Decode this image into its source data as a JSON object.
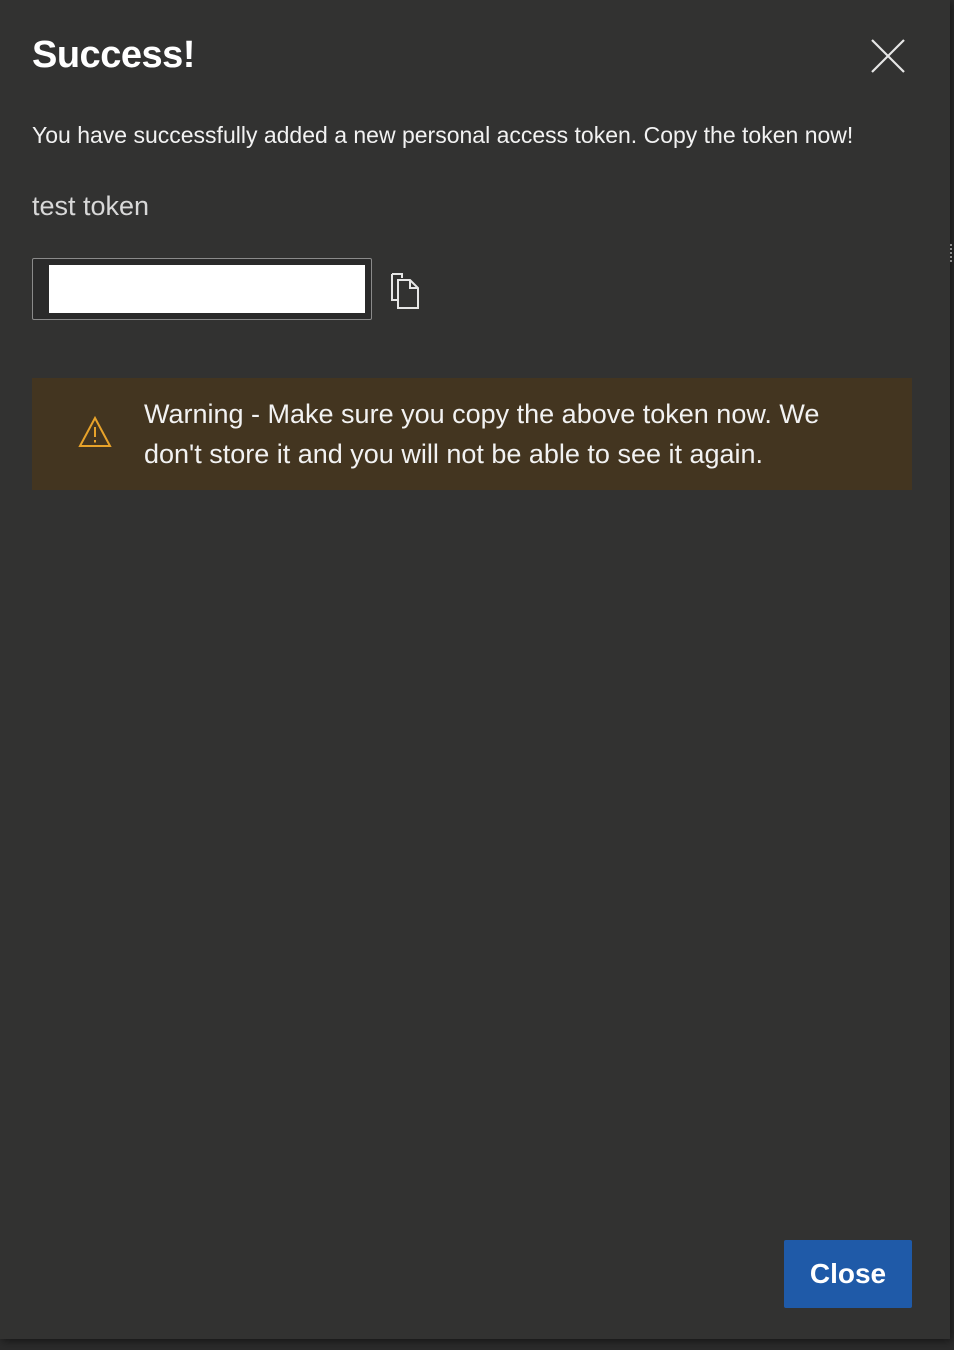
{
  "dialog": {
    "title": "Success!",
    "close_icon": "close-icon",
    "message": "You have successfully added a new personal access token. Copy the token now!",
    "token_name": "test token",
    "token_value": "",
    "copy_icon": "copy-icon",
    "warning": {
      "icon": "warning-icon",
      "text": "Warning - Make sure you copy the above token now. We don't store it and you will not be able to see it again.",
      "background_color": "#433520",
      "icon_color": "#e8a32a"
    },
    "close_button_label": "Close",
    "accent_color": "#1f5aa8"
  }
}
